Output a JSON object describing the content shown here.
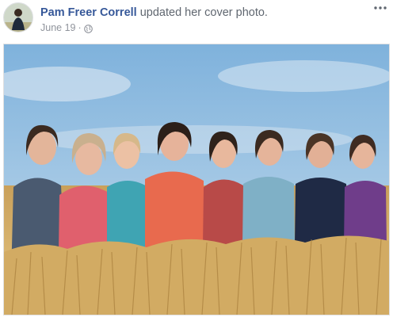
{
  "post": {
    "author_name": "Pam Freer Correll",
    "action_text": "updated her cover photo.",
    "date": "June 19",
    "separator": "·",
    "privacy_icon": "globe-icon",
    "menu_icon": "more-options-icon"
  },
  "photo": {
    "description_icon": "cover-photo",
    "people_count": 8
  },
  "colors": {
    "author_link": "#365899",
    "secondary_text": "#606770",
    "meta_text": "#90949c"
  }
}
